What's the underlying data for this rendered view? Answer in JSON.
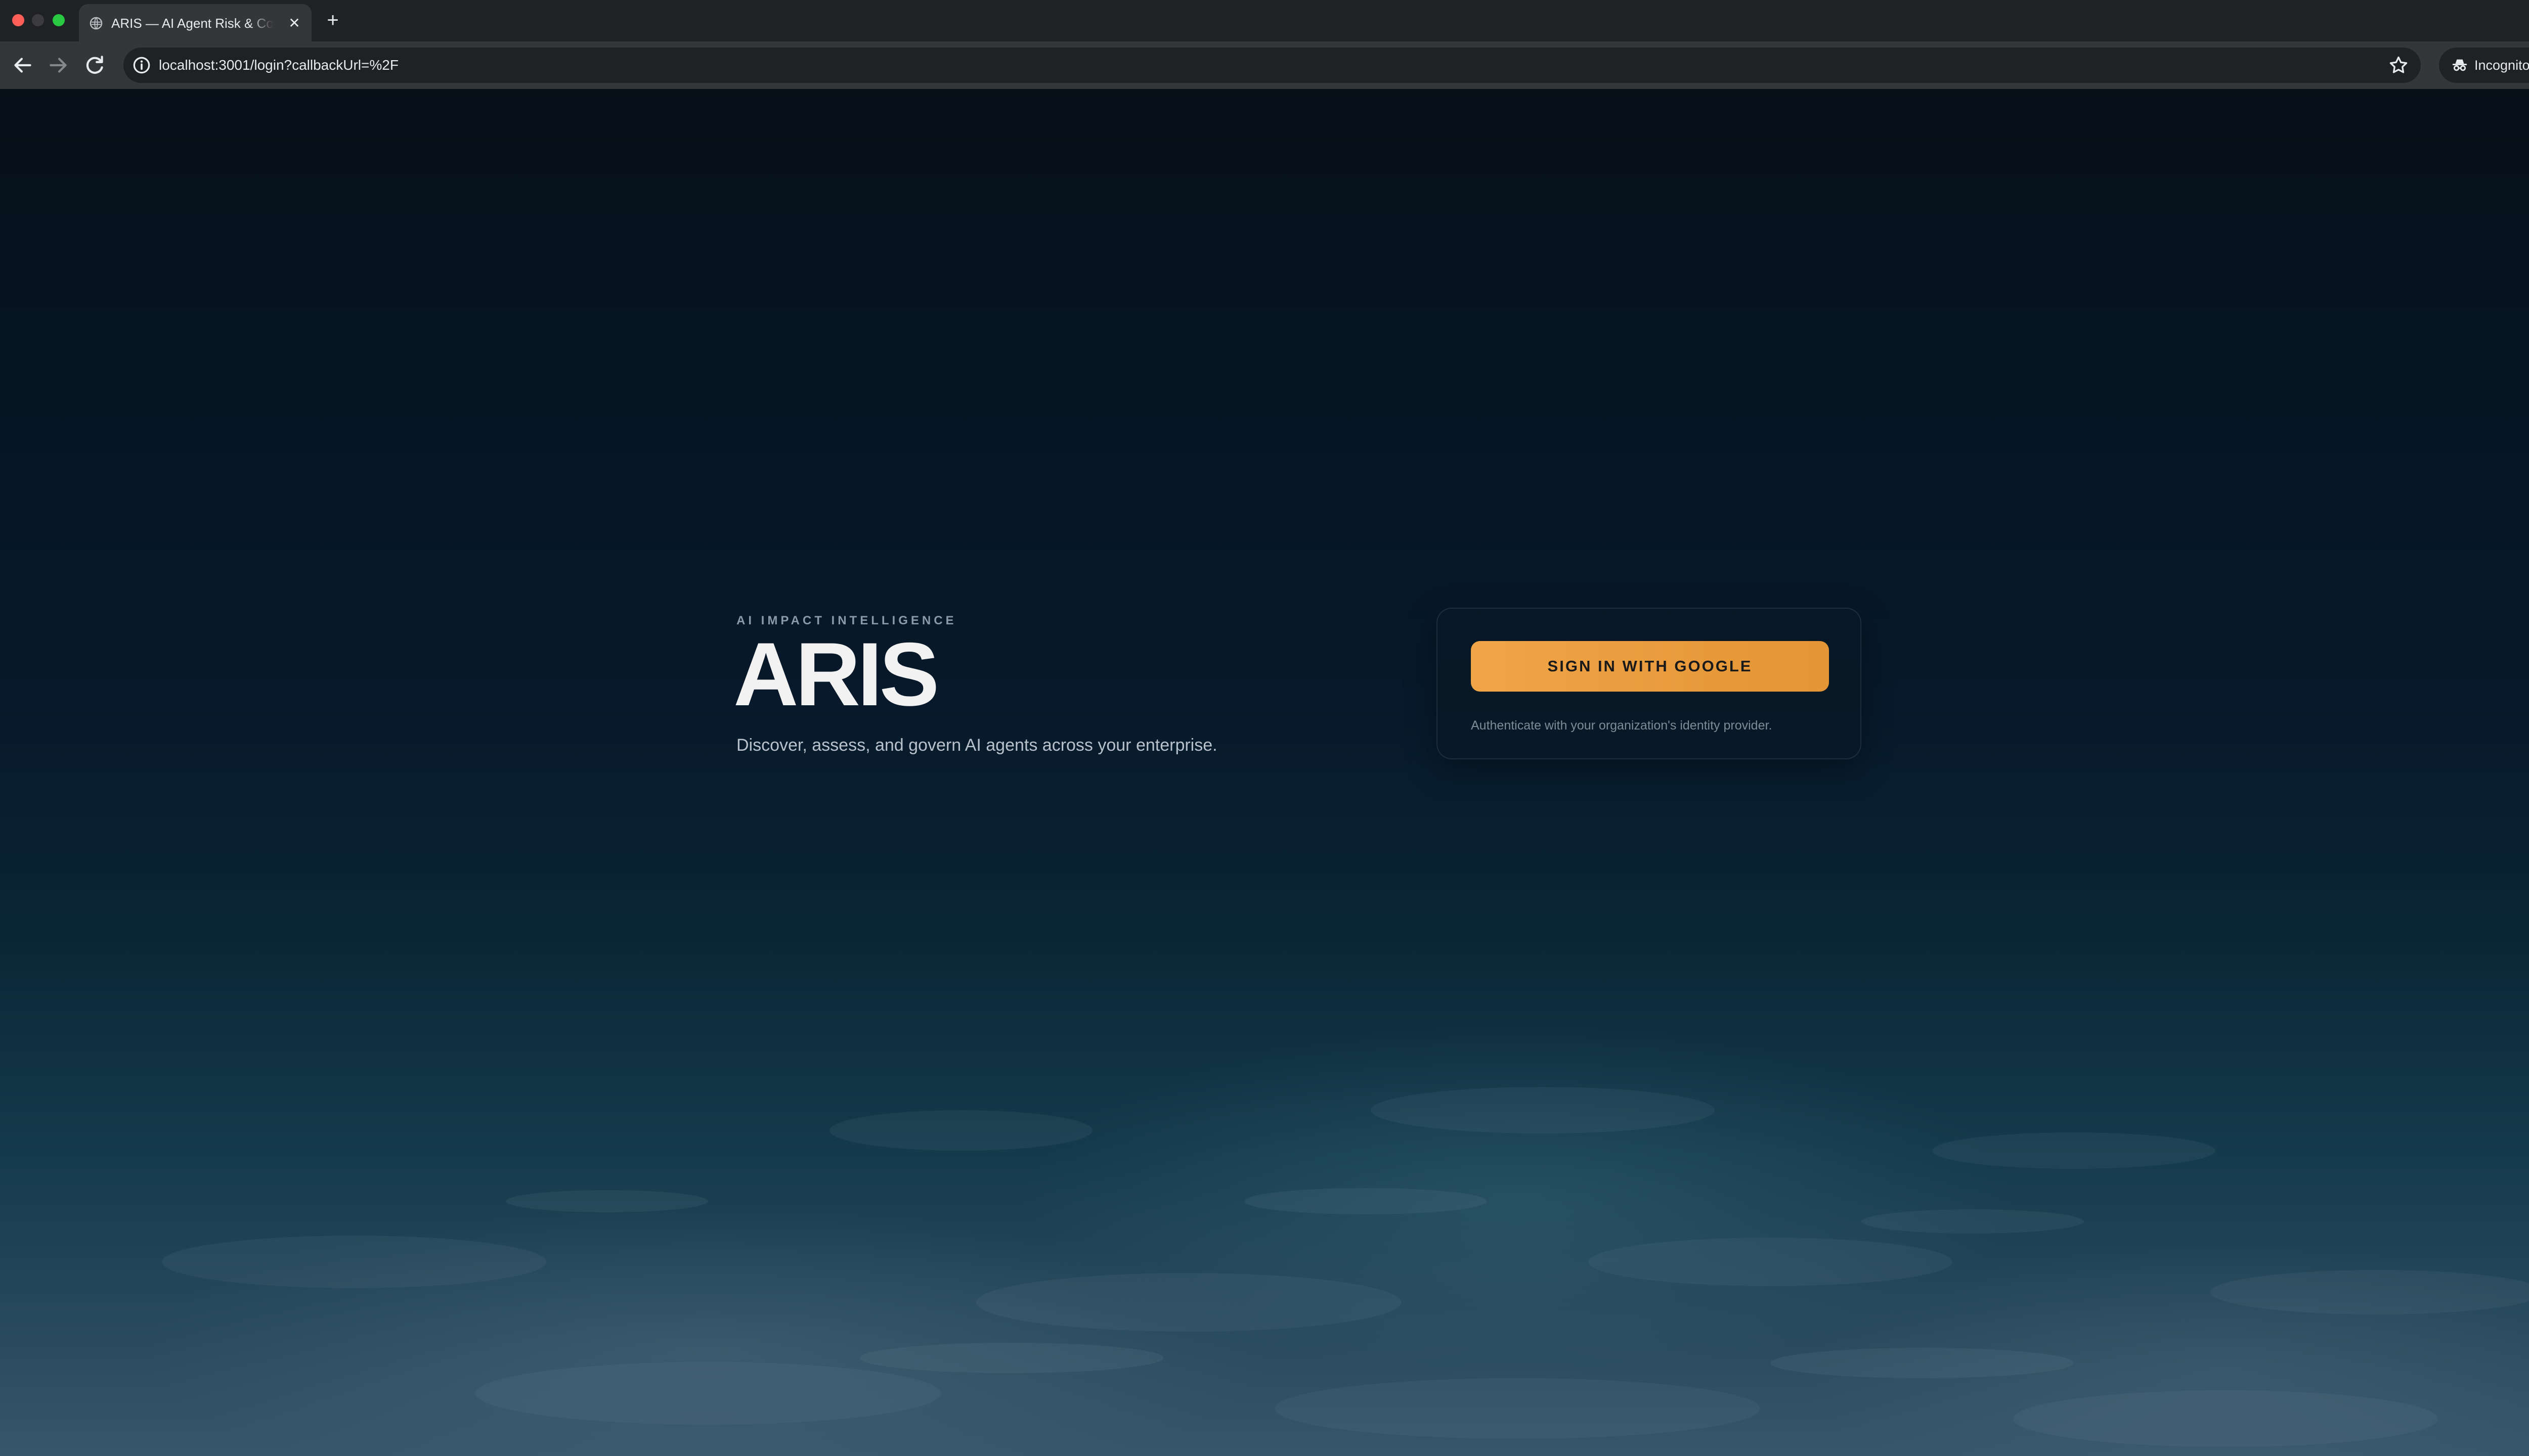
{
  "browser": {
    "tab": {
      "title": "ARIS — AI Agent Risk & Control",
      "close_glyph": "✕"
    },
    "new_tab_glyph": "+",
    "address_bar": {
      "url": "localhost:3001/login?callbackUrl=%2F"
    },
    "profile": {
      "label": "Incognito"
    },
    "icons": {
      "back": "arrow-left-icon",
      "forward": "arrow-right-icon",
      "reload": "reload-icon",
      "site_info": "info-icon",
      "bookmark": "star-icon",
      "incognito": "incognito-icon",
      "menu": "kebab-menu-icon",
      "tab_search": "chevron-down-icon"
    }
  },
  "hero": {
    "eyebrow": "AI IMPACT INTELLIGENCE",
    "brand": "ARIS",
    "tagline": "Discover, assess, and govern AI agents across your enterprise."
  },
  "signin": {
    "button_label": "SIGN IN WITH GOOGLE",
    "note": "Authenticate with your organization's identity provider."
  },
  "colors": {
    "accent": "#f0a547",
    "background": "#06111c",
    "text_primary": "#f2f2f2"
  }
}
